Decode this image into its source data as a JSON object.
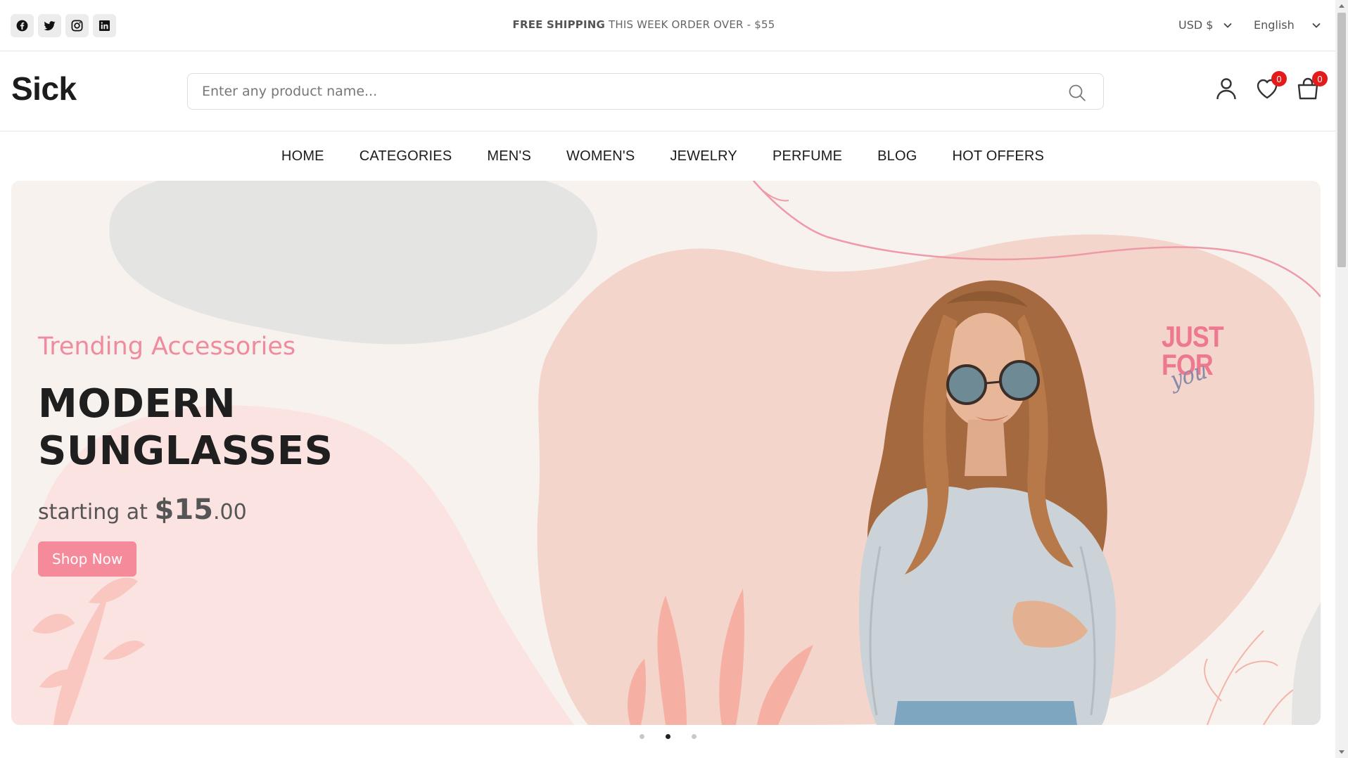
{
  "topbar": {
    "socials": [
      "facebook-icon",
      "twitter-icon",
      "instagram-icon",
      "linkedin-icon"
    ],
    "shipping_bold": "FREE SHIPPING",
    "shipping_rest": " THIS WEEK ORDER OVER - $55",
    "currency": "USD $",
    "language": "English"
  },
  "header": {
    "logo": "Sick",
    "search_placeholder": "Enter any product name...",
    "wishlist_count": "0",
    "cart_count": "0"
  },
  "nav": {
    "items": [
      "HOME",
      "CATEGORIES",
      "MEN'S",
      "WOMEN'S",
      "JEWELRY",
      "PERFUME",
      "BLOG",
      "HOT OFFERS"
    ]
  },
  "hero": {
    "subtitle": "Trending Accessories",
    "title_line1": "MODERN",
    "title_line2": "SUNGLASSES",
    "price_prefix": "starting at ",
    "price_main": "$15",
    "price_cents": ".00",
    "button": "Shop Now",
    "badge_line1": "JUST",
    "badge_line2": "FOR",
    "badge_line3": "you"
  },
  "slider": {
    "active_index": 1,
    "count": 3
  },
  "colors": {
    "accent": "#f58a9a",
    "badge": "#e31b1b",
    "subtitle": "#f08a9c"
  }
}
